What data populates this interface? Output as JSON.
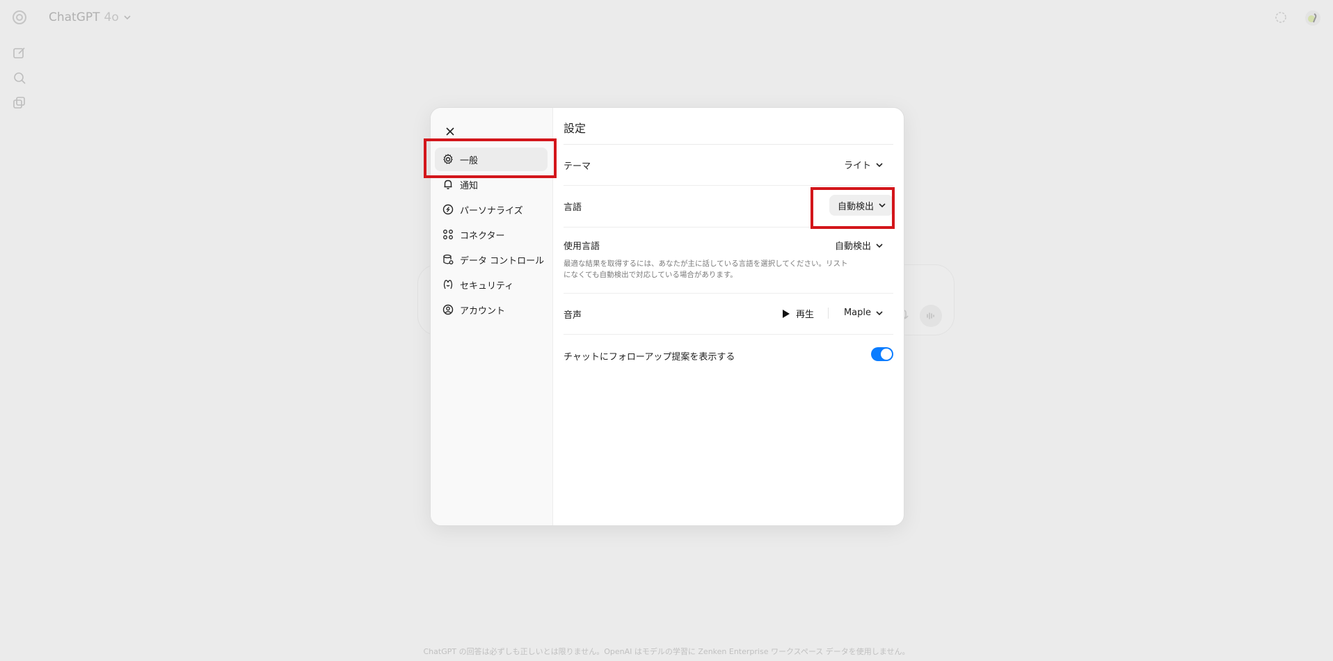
{
  "app": {
    "model_name": "ChatGPT",
    "model_version": "4o",
    "disclaimer": "ChatGPT の回答は必ずしも正しいとは限りません。OpenAI はモデルの学習に Zenken Enterprise ワークスペース データを使用しません。"
  },
  "settings": {
    "title": "設定",
    "nav": [
      {
        "label": "一般",
        "icon": "gear-icon",
        "active": true
      },
      {
        "label": "通知",
        "icon": "bell-icon"
      },
      {
        "label": "パーソナライズ",
        "icon": "personalize-icon"
      },
      {
        "label": "コネクター",
        "icon": "connectors-icon"
      },
      {
        "label": "データ コントロール",
        "icon": "data-controls-icon"
      },
      {
        "label": "セキュリティ",
        "icon": "security-icon"
      },
      {
        "label": "アカウント",
        "icon": "account-icon"
      }
    ],
    "theme": {
      "label": "テーマ",
      "value": "ライト"
    },
    "language": {
      "label": "言語",
      "value": "自動検出"
    },
    "spoken_language": {
      "label": "使用言語",
      "value": "自動検出",
      "help": "最適な結果を取得するには、あなたが主に話している言語を選択してください。リストになくても自動検出で対応している場合があります。"
    },
    "voice": {
      "label": "音声",
      "play_label": "再生",
      "value": "Maple"
    },
    "follow_up": {
      "label": "チャットにフォローアップ提案を表示する",
      "enabled": true
    }
  },
  "colors": {
    "accent": "#0a7cff",
    "annotation": "#d3161b"
  }
}
